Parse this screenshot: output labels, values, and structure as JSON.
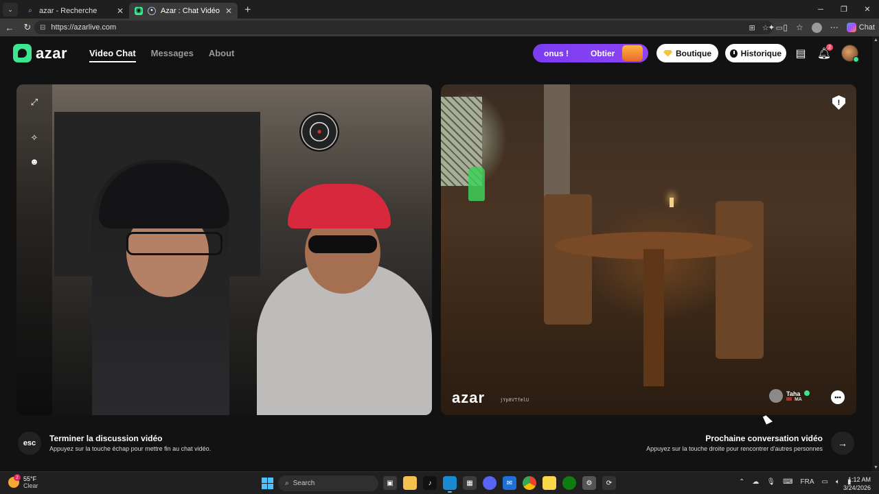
{
  "browser": {
    "tabs": [
      {
        "title": "azar - Recherche",
        "active": false
      },
      {
        "title": "Azar : Chat Vidéo avec de nou",
        "active": true
      }
    ],
    "url": "https://azarlive.com",
    "copilot_label": "Chat"
  },
  "header": {
    "logo_text": "azar",
    "nav": [
      {
        "label": "Video Chat",
        "active": true
      },
      {
        "label": "Messages",
        "active": false
      },
      {
        "label": "About",
        "active": false
      }
    ],
    "bonus": {
      "left": "onus !",
      "right": "Obtier"
    },
    "boutique_label": "Boutique",
    "historique_label": "Historique",
    "notification_count": "2"
  },
  "remote_video": {
    "watermark": "azar",
    "watermark_code": "jYp8VTfmlU",
    "peer": {
      "name": "Taha",
      "country": "MA"
    }
  },
  "controls": {
    "esc_key": "esc",
    "end_title": "Terminer la discussion vidéo",
    "end_subtitle": "Appuyez sur la touche échap pour mettre fin au chat vidéo.",
    "next_title": "Prochaine conversation vidéo",
    "next_subtitle": "Appuyez sur la touche droite pour rencontrer d'autres personnes"
  },
  "taskbar": {
    "weather_temp": "55°F",
    "weather_desc": "Clear",
    "weather_badge": "2",
    "search_placeholder": "Search",
    "lang": "FRA",
    "time": "1:12 AM",
    "date": "3/24/2026"
  },
  "colors": {
    "accent_green": "#3ae68f",
    "bonus_purple": "#7b3cf0",
    "page_bg": "#121212"
  }
}
